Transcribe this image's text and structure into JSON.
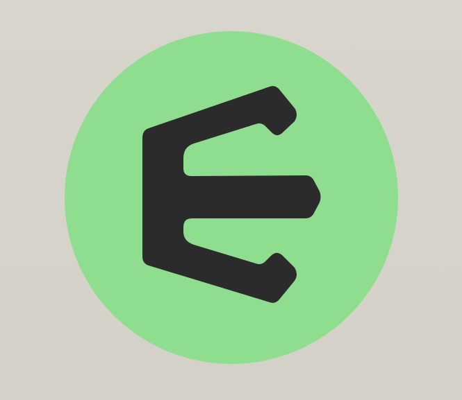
{
  "colors": {
    "background": "#d6d3ca",
    "circle": "#8fdd8f",
    "glyph": "#2b2b2b"
  },
  "logo": {
    "icon": "e-letter-logo-icon"
  }
}
